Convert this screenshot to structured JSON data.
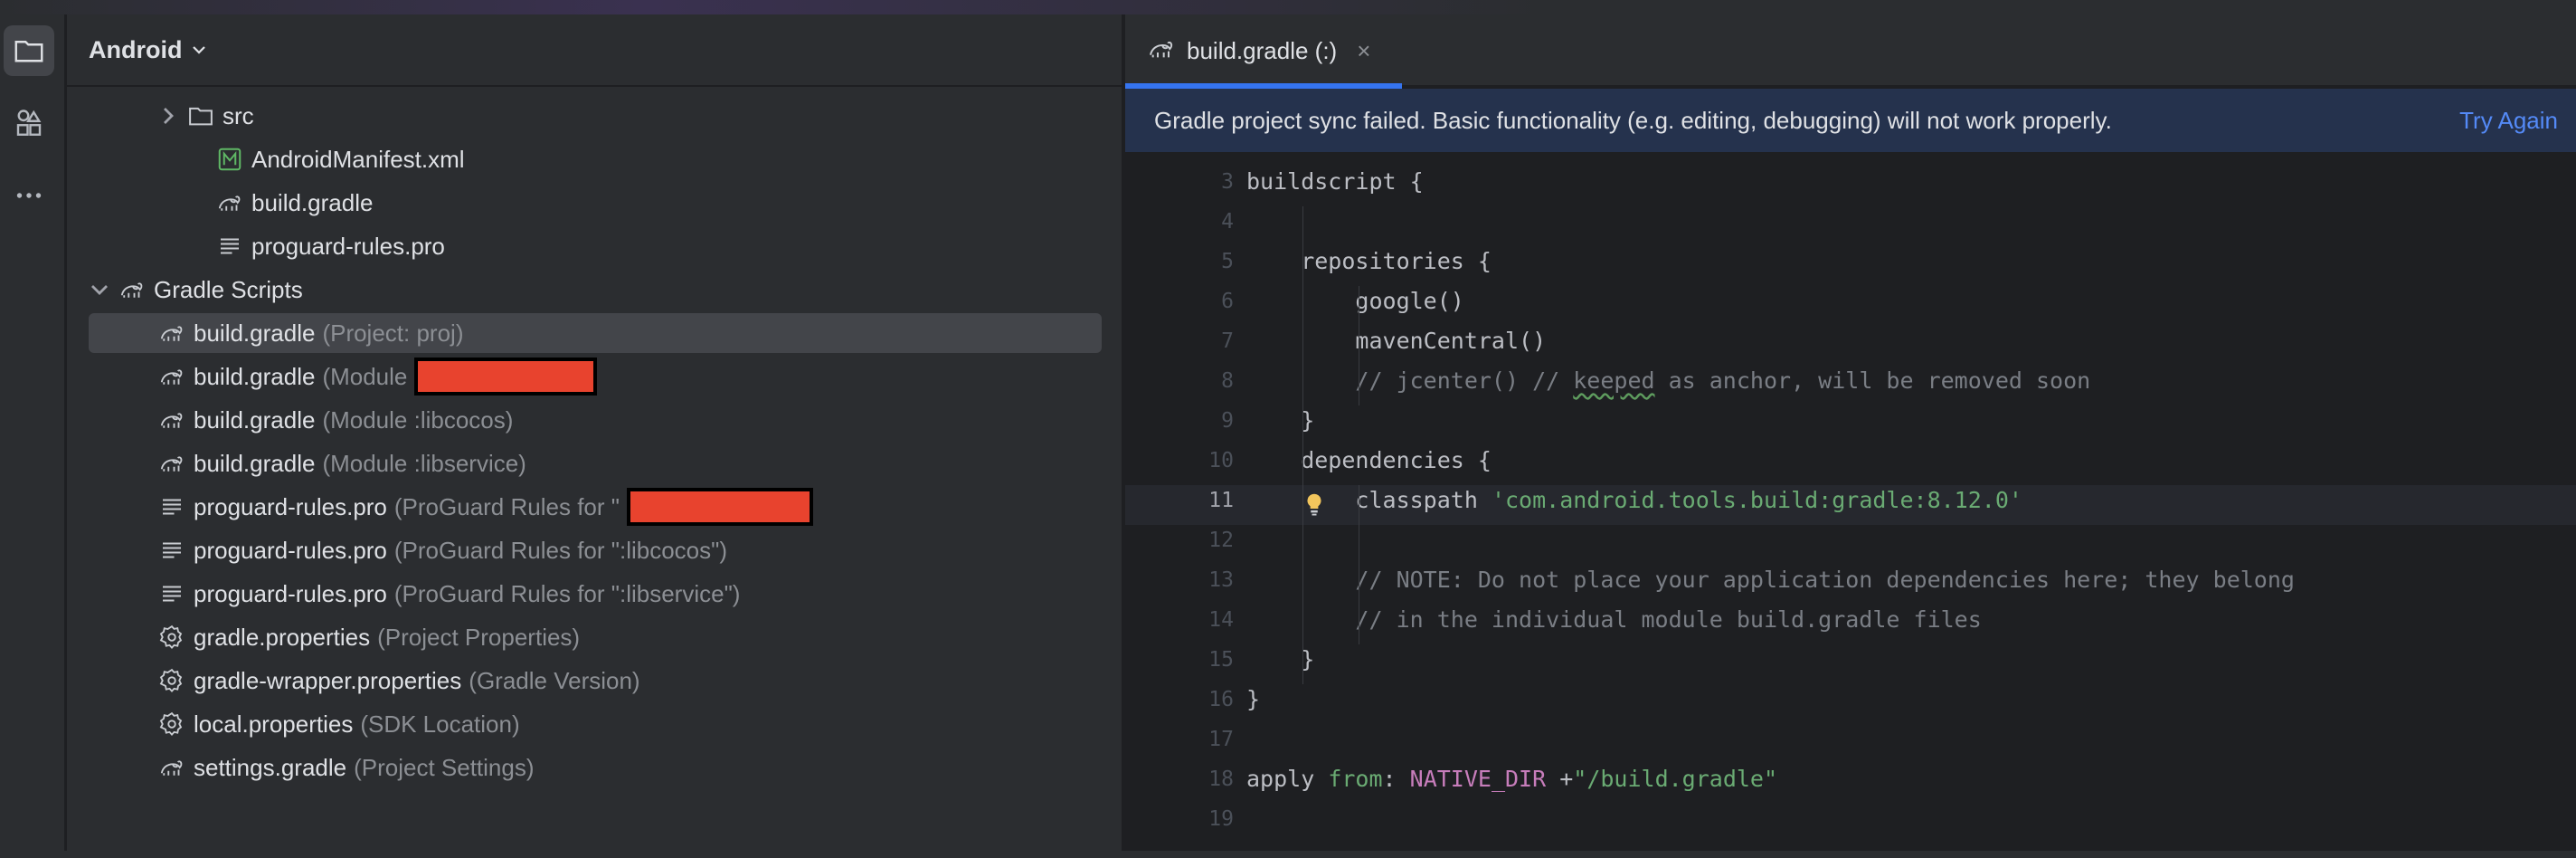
{
  "project": {
    "title": "Android",
    "rows": [
      {
        "name": "src",
        "hint": "",
        "icon": "folder-icon",
        "indent": 1,
        "expanded": false,
        "has_arrow": true
      },
      {
        "name": "AndroidManifest.xml",
        "hint": "",
        "icon": "manifest-icon",
        "indent": 1,
        "has_arrow": false
      },
      {
        "name": "build.gradle",
        "hint": "",
        "icon": "gradle-icon",
        "indent": 1,
        "has_arrow": false
      },
      {
        "name": "proguard-rules.pro",
        "hint": "",
        "icon": "text-file-icon",
        "indent": 1,
        "has_arrow": false
      },
      {
        "name": "Gradle Scripts",
        "hint": "",
        "icon": "gradle-icon",
        "indent": 0,
        "expanded": true,
        "has_arrow": true
      },
      {
        "name": "build.gradle",
        "hint": "(Project: proj)",
        "icon": "gradle-icon",
        "indent": 2,
        "selected": true
      },
      {
        "name": "build.gradle",
        "hint": "(Module",
        "icon": "gradle-icon",
        "indent": 2,
        "redacted": true
      },
      {
        "name": "build.gradle",
        "hint": "(Module :libcocos)",
        "icon": "gradle-icon",
        "indent": 2
      },
      {
        "name": "build.gradle",
        "hint": "(Module :libservice)",
        "icon": "gradle-icon",
        "indent": 2
      },
      {
        "name": "proguard-rules.pro",
        "hint": "(ProGuard Rules for \"",
        "icon": "text-file-icon",
        "indent": 2,
        "redacted": true
      },
      {
        "name": "proguard-rules.pro",
        "hint": "(ProGuard Rules for \":libcocos\")",
        "icon": "text-file-icon",
        "indent": 2
      },
      {
        "name": "proguard-rules.pro",
        "hint": "(ProGuard Rules for \":libservice\")",
        "icon": "text-file-icon",
        "indent": 2
      },
      {
        "name": "gradle.properties",
        "hint": "(Project Properties)",
        "icon": "settings-gear-icon",
        "indent": 2
      },
      {
        "name": "gradle-wrapper.properties",
        "hint": "(Gradle Version)",
        "icon": "settings-gear-icon",
        "indent": 2
      },
      {
        "name": "local.properties",
        "hint": "(SDK Location)",
        "icon": "settings-gear-icon",
        "indent": 2
      },
      {
        "name": "settings.gradle",
        "hint": "(Project Settings)",
        "icon": "gradle-icon",
        "indent": 2
      }
    ]
  },
  "editor": {
    "tab": {
      "label": "build.gradle (:)",
      "close": "×"
    },
    "banner": {
      "text": "Gradle project sync failed. Basic functionality (e.g. editing, debugging) will not work properly.",
      "action": "Try Again"
    },
    "current_line": 11,
    "lines": [
      {
        "n": "3",
        "segs": [
          {
            "t": "buildscript {",
            "c": ""
          }
        ]
      },
      {
        "n": "4",
        "segs": []
      },
      {
        "n": "5",
        "segs": [
          {
            "t": "    repositories {",
            "c": ""
          }
        ]
      },
      {
        "n": "6",
        "segs": [
          {
            "t": "        google()",
            "c": ""
          }
        ]
      },
      {
        "n": "7",
        "segs": [
          {
            "t": "        mavenCentral()",
            "c": ""
          }
        ]
      },
      {
        "n": "8",
        "segs": [
          {
            "t": "        // jcenter() // ",
            "c": "cm"
          },
          {
            "t": "keeped",
            "c": "cm wavy"
          },
          {
            "t": " as anchor, will be removed soon",
            "c": "cm"
          }
        ]
      },
      {
        "n": "9",
        "segs": [
          {
            "t": "    }",
            "c": ""
          }
        ]
      },
      {
        "n": "10",
        "segs": [
          {
            "t": "    dependencies {",
            "c": ""
          }
        ]
      },
      {
        "n": "11",
        "segs": [
          {
            "t": "        classpath ",
            "c": ""
          },
          {
            "t": "'com.android.tools.build:gradle:8.12.0'",
            "c": "str"
          }
        ]
      },
      {
        "n": "12",
        "segs": []
      },
      {
        "n": "13",
        "segs": [
          {
            "t": "        // NOTE: Do not place your application dependencies here; they belong",
            "c": "cm"
          }
        ]
      },
      {
        "n": "14",
        "segs": [
          {
            "t": "        // in the individual module build.gradle files",
            "c": "cm"
          }
        ]
      },
      {
        "n": "15",
        "segs": [
          {
            "t": "    }",
            "c": ""
          }
        ]
      },
      {
        "n": "16",
        "segs": [
          {
            "t": "}",
            "c": ""
          }
        ]
      },
      {
        "n": "17",
        "segs": []
      },
      {
        "n": "18",
        "segs": [
          {
            "t": "apply ",
            "c": ""
          },
          {
            "t": "from",
            "c": "grn"
          },
          {
            "t": ": ",
            "c": ""
          },
          {
            "t": "NATIVE_DIR",
            "c": "cn"
          },
          {
            "t": " +",
            "c": ""
          },
          {
            "t": "\"/build.gradle\"",
            "c": "str"
          }
        ]
      },
      {
        "n": "19",
        "segs": []
      }
    ]
  },
  "colors": {
    "accent": "#3574f0",
    "banner_bg": "#25324d",
    "link": "#548af7",
    "redaction": "#e8432e",
    "string": "#6aab73",
    "comment": "#7a7e85",
    "constant": "#c77dbb"
  }
}
